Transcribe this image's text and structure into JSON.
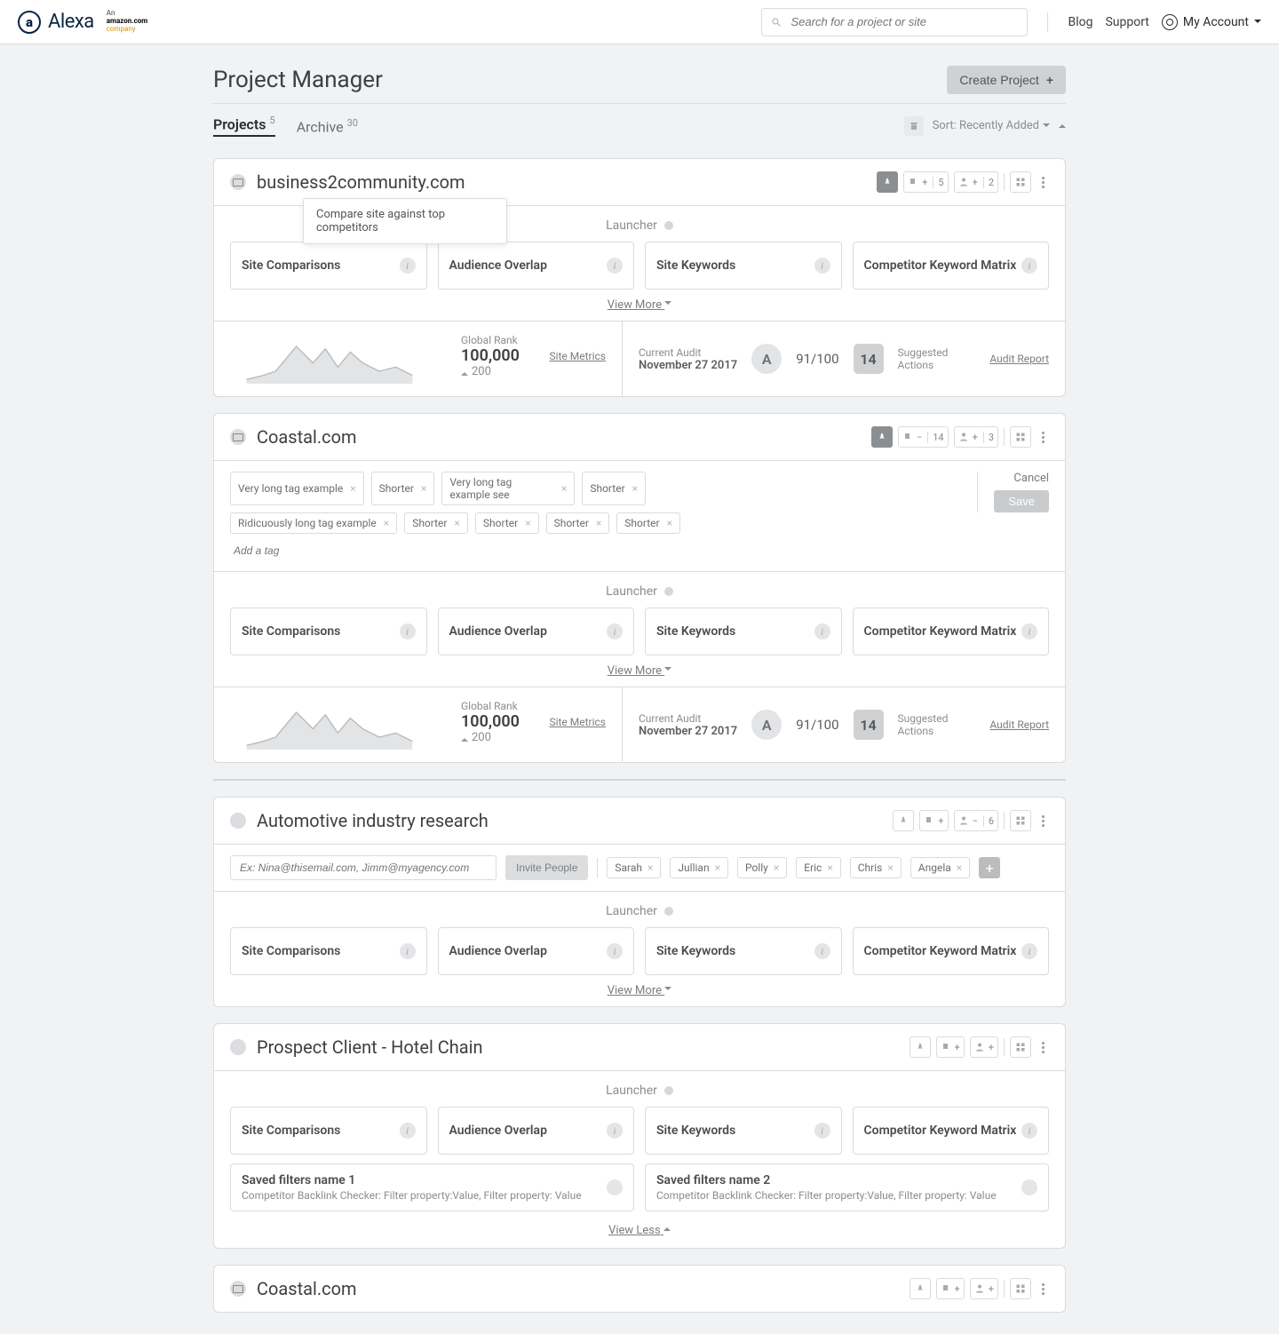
{
  "header": {
    "brand": "Alexa",
    "amazon_line1": "An",
    "amazon_line2": "amazon.com",
    "amazon_line3": "company",
    "search_placeholder": "Search for a project or site",
    "blog": "Blog",
    "support": "Support",
    "account": "My Account"
  },
  "page": {
    "title": "Project Manager",
    "create": "Create Project",
    "tabs": {
      "projects": "Projects",
      "projects_n": "5",
      "archive": "Archive",
      "archive_n": "30"
    },
    "sort": "Sort: Recently Added"
  },
  "tools": {
    "t1": "Site Comparisons",
    "t2": "Audience Overlap",
    "t3": "Site Keywords",
    "t4": "Competitor Keyword Matrix",
    "launcher": "Launcher",
    "viewmore": "View More",
    "viewless": "View Less"
  },
  "rank": {
    "label": "Global Rank",
    "value": "100,000",
    "delta": "200",
    "link": "Site Metrics"
  },
  "audit": {
    "label": "Current Audit",
    "date": "November 27 2017",
    "grade": "A",
    "score": "91/100",
    "actions_n": "14",
    "actions_lbl": "Suggested Actions",
    "report": "Audit Report"
  },
  "tooltip": "Compare site against top competitors",
  "p1": {
    "title": "business2community.com",
    "briefcase": "5",
    "user": "2"
  },
  "p2": {
    "title": "Coastal.com",
    "briefcase": "14",
    "user": "3",
    "tags": [
      "Very long tag example",
      "Shorter",
      "Very long tag example see",
      "Shorter",
      "Ridicuously long tag example",
      "Shorter",
      "Shorter",
      "Shorter",
      "Shorter"
    ],
    "addtag": "Add a tag",
    "cancel": "Cancel",
    "save": "Save"
  },
  "p3": {
    "title": "Automotive industry research",
    "user": "6",
    "invite_ph": "Ex: Nina@thisemail.com, Jimm@myagency.com",
    "invite_btn": "Invite People",
    "people": [
      "Sarah",
      "Jullian",
      "Polly",
      "Eric",
      "Chris",
      "Angela"
    ]
  },
  "p4": {
    "title": "Prospect Client - Hotel Chain",
    "f1": {
      "name": "Saved filters name 1",
      "desc": "Competitor Backlink Checker: Filter property:Value, Filter property: Value"
    },
    "f2": {
      "name": "Saved filters name 2",
      "desc": "Competitor Backlink Checker: Filter property:Value, Filter property: Value"
    }
  },
  "p5": {
    "title": "Coastal.com"
  }
}
